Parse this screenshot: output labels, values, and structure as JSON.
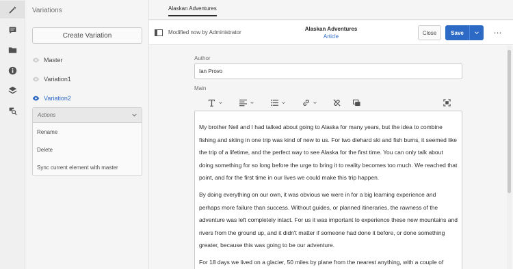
{
  "rail": {
    "items": [
      "edit-icon",
      "comment-icon",
      "folder-icon",
      "info-icon",
      "layers-icon",
      "search-asset-icon"
    ]
  },
  "panel": {
    "title": "Variations",
    "create_button": "Create Variation",
    "variations": [
      {
        "label": "Master"
      },
      {
        "label": "Variation1"
      },
      {
        "label": "Variation2"
      }
    ],
    "actions": {
      "header": "Actions",
      "items": [
        "Rename",
        "Delete",
        "Sync current element with master"
      ]
    }
  },
  "tabs": [
    {
      "label": "Alaskan Adventures"
    }
  ],
  "header": {
    "status": "Modified now by Administrator",
    "title": "Alaskan Adventures",
    "subtitle": "Article",
    "close_label": "Close",
    "save_label": "Save"
  },
  "form": {
    "author_label": "Author",
    "author_value": "Ian Provo",
    "main_label": "Main",
    "paragraphs": [
      "My brother Neil and I had talked about going to Alaska for many years, but the idea to combine fishing and skiing in one trip was kind of new to us. For two diehard ski and fish bums, it seemed like the trip of a lifetime, and the perfect way to see Alaska for the first time. You can only talk about doing something for so long before the urge to bring it to reality becomes too much. We reached that point, and for the first time in our lives we could make this trip happen.",
      "By doing everything on our own, it was obvious we were in for a big learning experience and perhaps more failure than success. Without guides, or planned itineraries, the rawness of the adventure was left completely intact. For us it was important to experience these new mountains and rivers from the ground up, and it didn't matter if someone had done it before, or done something greater, because this was going to be our adventure.",
      "For 18 days we lived on a glacier, 50 miles by plane from the nearest anything, with a couple of"
    ]
  },
  "colors": {
    "accent": "#2d6ac6",
    "panel_bg": "#f5f5f5"
  }
}
